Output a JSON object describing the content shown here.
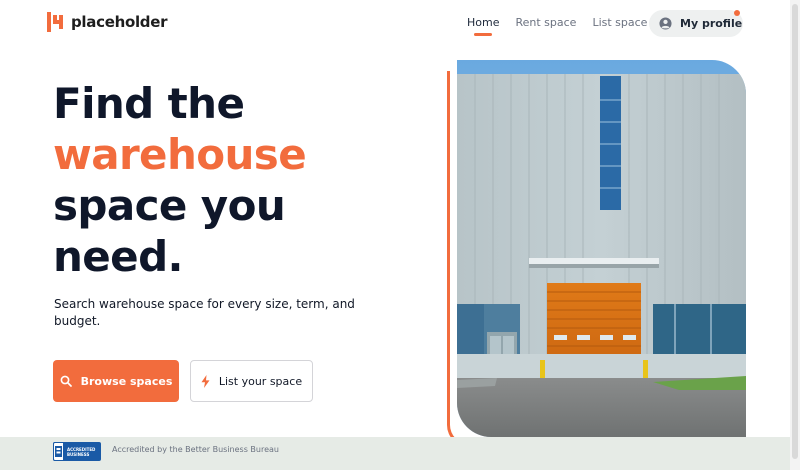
{
  "header": {
    "logo_text": "placeholder",
    "nav": [
      {
        "label": "Home",
        "active": true
      },
      {
        "label": "Rent space",
        "active": false
      },
      {
        "label": "List space",
        "active": false
      }
    ],
    "profile_label": "My profile"
  },
  "hero": {
    "title_line1": "Find the",
    "title_accent": "warehouse",
    "title_line3": "space you",
    "title_line4": "need.",
    "subtitle": "Search warehouse space for every size, term, and budget.",
    "browse_label": "Browse spaces",
    "list_label": "List your space",
    "image_icon": "warehouse-photo"
  },
  "footer": {
    "badge_text": "ACCREDITED BUSINESS",
    "accreditation": "Accredited by the Better Business Bureau"
  },
  "colors": {
    "accent": "#f26c3d",
    "dark_text": "#0f172a",
    "footer_band": "#e6ebe6"
  },
  "icons": {
    "search": "search-icon",
    "bolt": "lightning-icon",
    "profile": "user-circle-icon"
  }
}
